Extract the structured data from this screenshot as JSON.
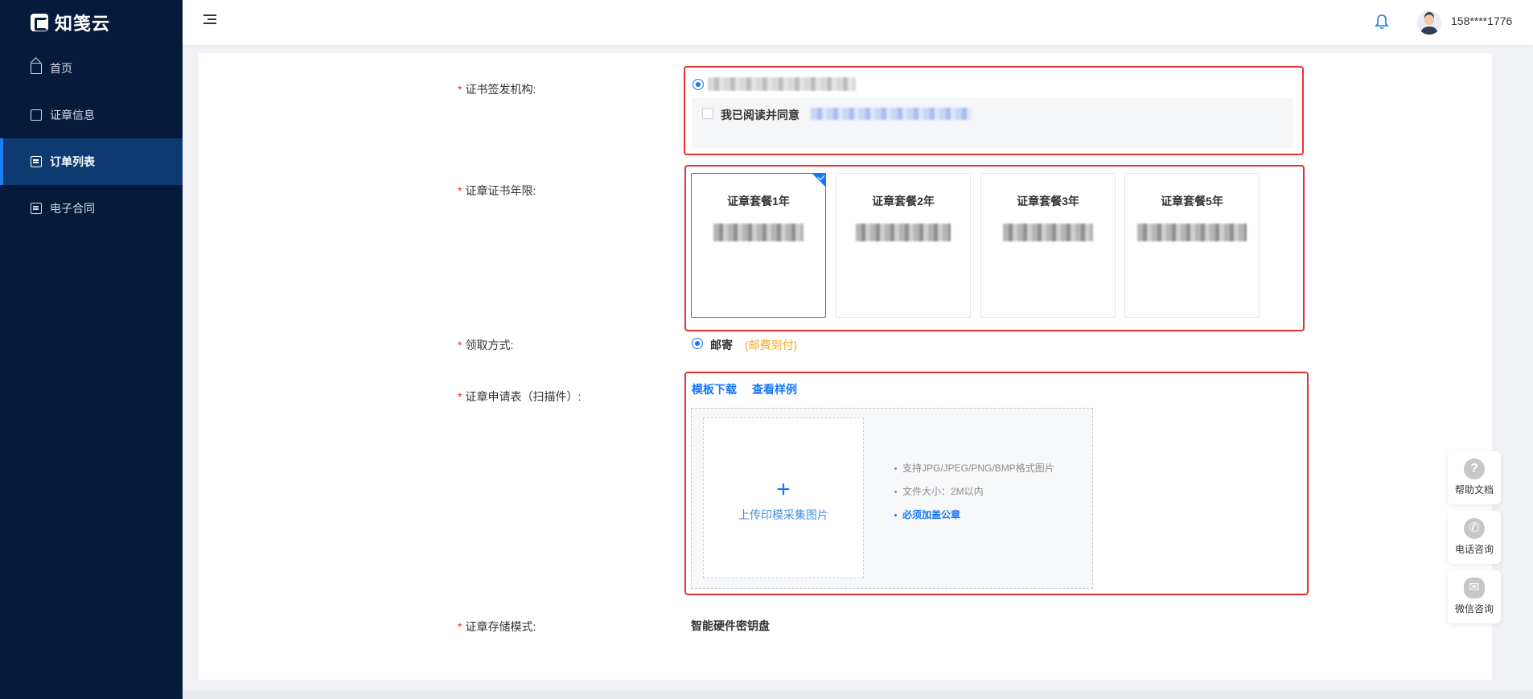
{
  "sidebar": {
    "logo": "知笺云",
    "items": [
      {
        "label": "首页",
        "icon": "home-icon"
      },
      {
        "label": "证章信息",
        "icon": "calendar-icon"
      },
      {
        "label": "订单列表",
        "icon": "list-icon"
      },
      {
        "label": "电子合同",
        "icon": "contract-icon"
      }
    ]
  },
  "header": {
    "phone": "158****1776"
  },
  "form": {
    "issuer": {
      "label": "证书签发机构:",
      "agree_text": "我已阅读并同意"
    },
    "term": {
      "label": "证章证书年限:",
      "plans": [
        {
          "title": "证章套餐1年"
        },
        {
          "title": "证章套餐2年"
        },
        {
          "title": "证章套餐3年"
        },
        {
          "title": "证章套餐5年"
        }
      ]
    },
    "delivery": {
      "label": "领取方式:",
      "option": "邮寄",
      "note": "(邮费到付)"
    },
    "application": {
      "label": "证章申请表（扫描件）:",
      "template_link": "模板下载",
      "sample_link": "查看样例",
      "upload_text": "上传印模采集图片",
      "tips": [
        "支持JPG/JPEG/PNG/BMP格式图片",
        "文件大小：2M以内",
        "必须加盖公章"
      ]
    },
    "storage": {
      "label": "证章存储模式:",
      "value": "智能硬件密钥盘"
    }
  },
  "float": {
    "help": "帮助文档",
    "phone": "电话咨询",
    "wechat": "微信咨询"
  },
  "colors": {
    "sidebar_bg": "#061b3b",
    "accent": "#1677ff",
    "highlight_box": "#e8302e",
    "note_orange": "#f5a623"
  }
}
